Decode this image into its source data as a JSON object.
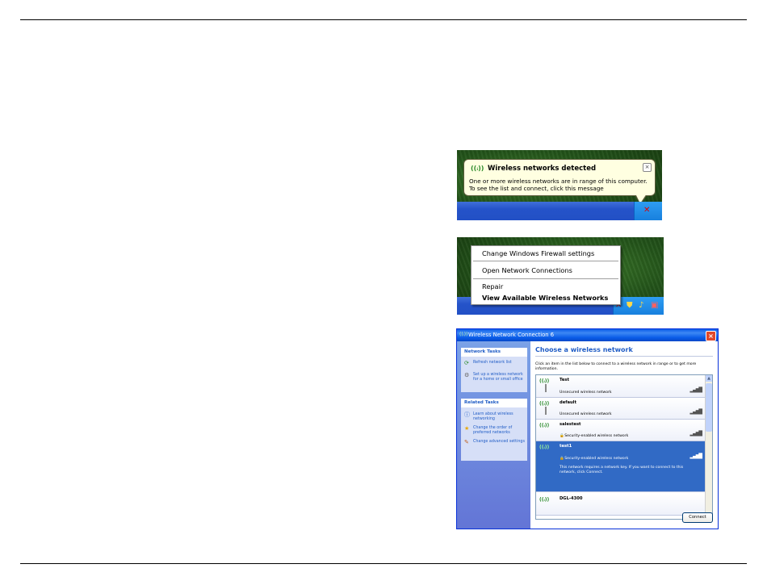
{
  "balloon": {
    "title": "Wireless networks detected",
    "line1": "One or more wireless networks are in range of this computer.",
    "line2": "To see the list and connect, click this message",
    "close": "×",
    "wifi_icon": "((ᵢ))"
  },
  "context_menu": {
    "items": [
      "Change Windows Firewall settings",
      "Open Network Connections",
      "Repair",
      "View Available Wireless Networks"
    ]
  },
  "window": {
    "title": "Wireless Network Connection 6",
    "close": "×",
    "network_tasks": {
      "header": "Network Tasks",
      "items": [
        "Refresh network list",
        "Set up a wireless network for a home or small office"
      ]
    },
    "related_tasks": {
      "header": "Related Tasks",
      "items": [
        "Learn about wireless networking",
        "Change the order of preferred networks",
        "Change advanced settings"
      ]
    },
    "main_title": "Choose a wireless network",
    "main_desc": "Click an item in the list below to connect to a wireless network in range or to get more information.",
    "networks": [
      {
        "name": "Test",
        "status": "Unsecured wireless network",
        "bars": "▂▄▆█"
      },
      {
        "name": "default",
        "status": "Unsecured wireless network",
        "bars": "▂▄▆█"
      },
      {
        "name": "salestest",
        "status": "Security-enabled wireless network",
        "bars": "▂▄▆█"
      },
      {
        "name": "test1",
        "status": "Security-enabled wireless network",
        "bars": "▂▄▆█",
        "extra": "This network requires a network key. If you want to connect to this network, click Connect."
      },
      {
        "name": "DGL-4300",
        "status": "",
        "bars": ""
      }
    ],
    "antenna_glyph": "((ᵢ))",
    "connect_label": "Connect"
  }
}
